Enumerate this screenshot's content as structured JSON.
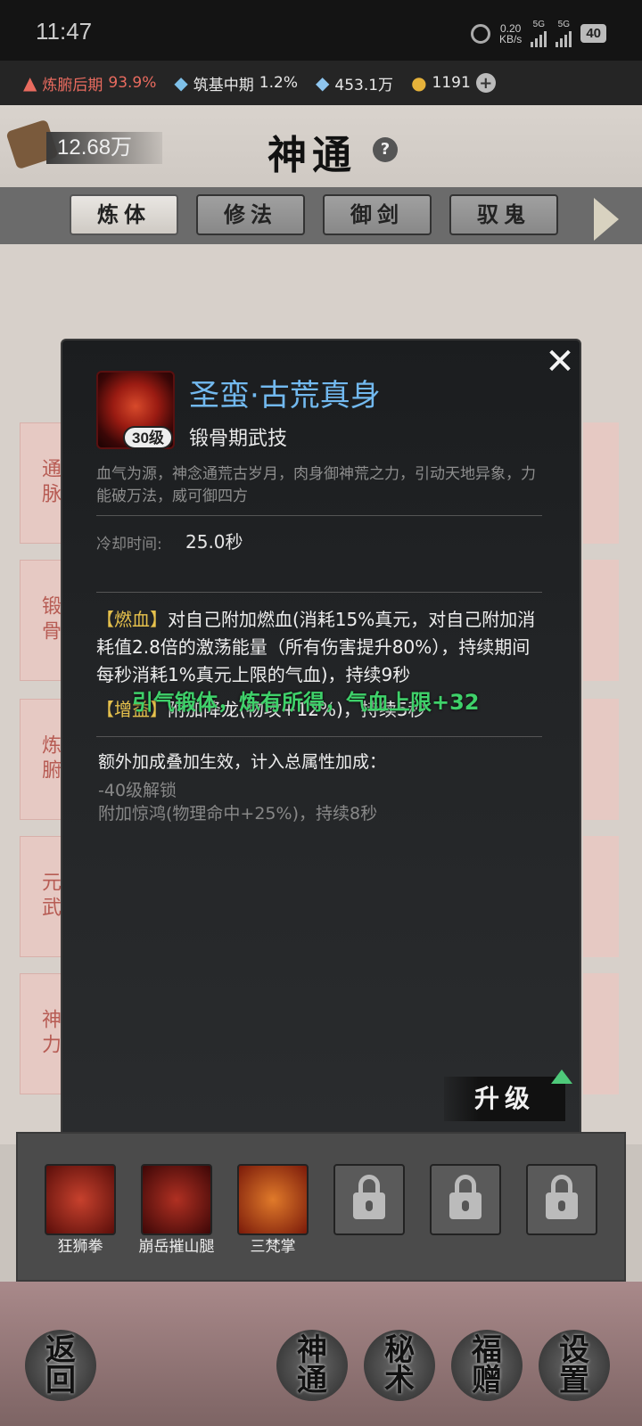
{
  "status": {
    "time": "11:47",
    "speed_top": "0.20",
    "speed_unit": "KB/s",
    "net1": "5G",
    "net2": "5G",
    "battery": "40"
  },
  "resources": [
    {
      "label": "炼腑后期",
      "value": "93.9%"
    },
    {
      "label": "筑基中期",
      "value": "1.2%"
    },
    {
      "value": "453.1万"
    },
    {
      "value": "1191"
    }
  ],
  "header": {
    "points": "12.68万",
    "title": "神通",
    "help": "?"
  },
  "tabs": [
    "炼体",
    "修法",
    "御剑",
    "驭鬼"
  ],
  "side_items": [
    "通脉",
    "锻骨",
    "炼腑",
    "元武",
    "神力"
  ],
  "dialog": {
    "level_badge": "30级",
    "skill_name": "圣蛮·古荒真身",
    "skill_type": "锻骨期武技",
    "description": "血气为源，神念通荒古岁月，肉身御神荒之力，引动天地异象，力能破万法，威可御四方",
    "cooldown_label": "冷却时间:",
    "cooldown_value": "25.0秒",
    "effect1_tag": "【燃血】",
    "effect1_text": "对自己附加燃血(消耗15%真元，对自己附加消耗值2.8倍的激荡能量（所有伤害提升80%），持续期间每秒消耗1%真元上限的气血)，持续9秒",
    "effect2_tag": "【增益】",
    "effect2_text": "附加降龙(物攻+12%)，持续5秒",
    "float_msg": "引气锻体，炼有所得，气血上限+32",
    "extra_title": "额外加成叠加生效，计入总属性加成：",
    "extra_lines": [
      "-40级解锁",
      "附加惊鸿(物理命中+25%)，持续8秒"
    ],
    "upgrade_label": "升级",
    "close": "✕"
  },
  "slots": [
    {
      "label": "狂狮拳"
    },
    {
      "label": "崩岳摧山腿"
    },
    {
      "label": "三梵掌"
    },
    {
      "label": ""
    },
    {
      "label": ""
    },
    {
      "label": ""
    }
  ],
  "nav": {
    "back": [
      "返",
      "回"
    ],
    "shentong": [
      "神",
      "通"
    ],
    "mishu": [
      "秘",
      "术"
    ],
    "fuzeng": [
      "福",
      "赠"
    ],
    "shezhi": [
      "设",
      "置"
    ]
  }
}
